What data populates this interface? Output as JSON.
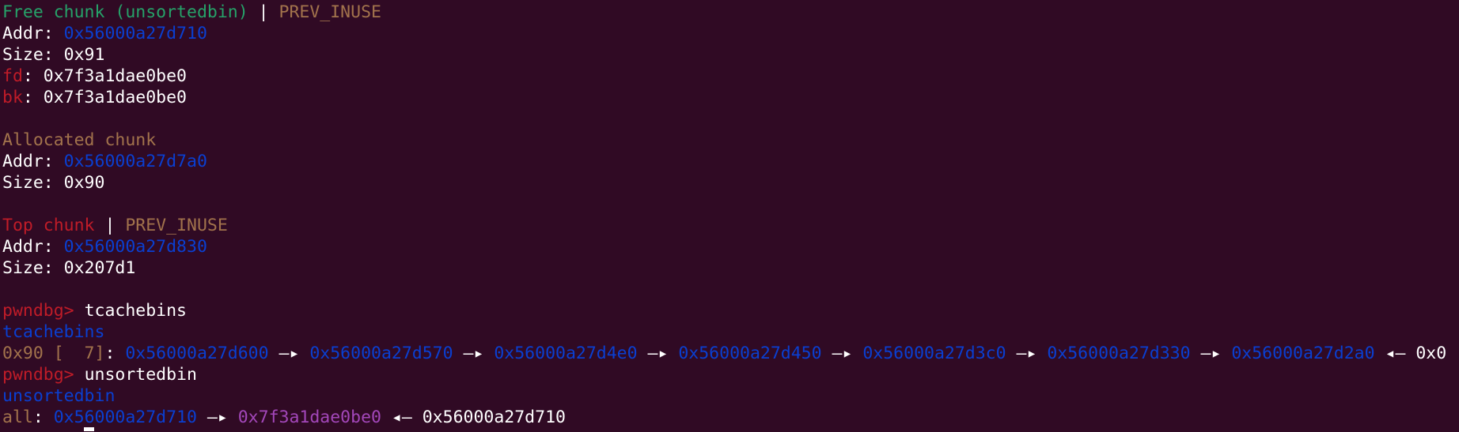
{
  "colors": {
    "background": "#300a24",
    "text": "#ffffff",
    "green": "#26a269",
    "orange": "#a2734c",
    "blue": "#0a3fd1",
    "red": "#c01c28",
    "purple": "#a347ba"
  },
  "free_chunk": {
    "title": "Free chunk (unsortedbin)",
    "separator": " | ",
    "flag": "PREV_INUSE",
    "addr_label": "Addr: ",
    "addr_value": "0x56000a27d710",
    "size_label": "Size: ",
    "size_value": "0x91",
    "fd_label": "fd",
    "fd_sep": ": ",
    "fd_value": "0x7f3a1dae0be0",
    "bk_label": "bk",
    "bk_sep": ": ",
    "bk_value": "0x7f3a1dae0be0"
  },
  "allocated_chunk": {
    "title": "Allocated chunk",
    "addr_label": "Addr: ",
    "addr_value": "0x56000a27d7a0",
    "size_label": "Size: ",
    "size_value": "0x90"
  },
  "top_chunk": {
    "title": "Top chunk",
    "separator": " | ",
    "flag": "PREV_INUSE",
    "addr_label": "Addr: ",
    "addr_value": "0x56000a27d830",
    "size_label": "Size: ",
    "size_value": "0x207d1"
  },
  "prompt": "pwndbg> ",
  "commands": [
    "tcachebins",
    "unsortedbin"
  ],
  "tcachebins": {
    "header": "tcachebins",
    "bin_label": "0x90 [  7]",
    "colon": ": ",
    "entries": [
      "0x56000a27d600",
      "0x56000a27d570",
      "0x56000a27d4e0",
      "0x56000a27d450",
      "0x56000a27d3c0",
      "0x56000a27d330",
      "0x56000a27d2a0"
    ],
    "arrow": " —▸ ",
    "back_arrow": " ◂— ",
    "terminator": "0x0"
  },
  "unsortedbin": {
    "header": "unsortedbin",
    "all_label": "all",
    "colon": ": ",
    "head": "0x56000a27d710",
    "arrow": " —▸ ",
    "libc_addr": "0x7f3a1dae0be0",
    "back_arrow": " ◂— ",
    "back_value": "0x56000a27d710"
  }
}
